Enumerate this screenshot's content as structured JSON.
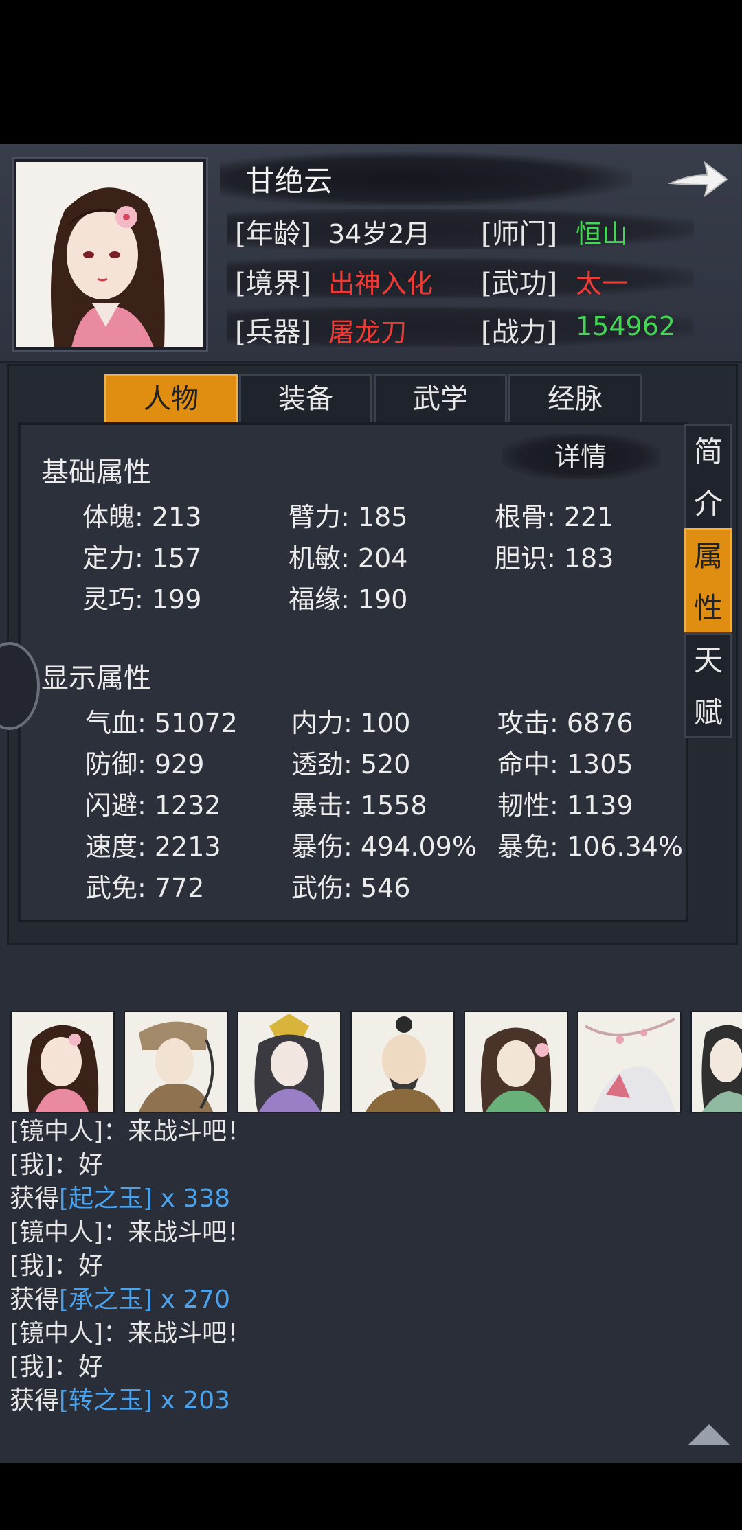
{
  "profile": {
    "name": "甘绝云",
    "rows": [
      {
        "label1": "[年龄]",
        "value1": "34岁2月",
        "label2": "[师门]",
        "value2": "恒山"
      },
      {
        "label1": "[境界]",
        "value1": "出神入化",
        "label2": "[武功]",
        "value2": "太一"
      },
      {
        "label1": "[兵器]",
        "value1": "屠龙刀",
        "label2": "[战力]",
        "value2": "154962"
      }
    ]
  },
  "tabs": [
    "人物",
    "装备",
    "武学",
    "经脉"
  ],
  "detail_label": "详情",
  "side_tabs": [
    {
      "chars": [
        "简",
        "介"
      ]
    },
    {
      "chars": [
        "属",
        "性"
      ]
    },
    {
      "chars": [
        "天",
        "赋"
      ]
    }
  ],
  "base_section": {
    "title": "基础属性",
    "stats": [
      "体魄: 213",
      "臂力: 185",
      "根骨: 221",
      "定力: 157",
      "机敏: 204",
      "胆识: 183",
      "灵巧: 199",
      "福缘: 190"
    ]
  },
  "display_section": {
    "title": "显示属性",
    "stats": [
      "气血: 51072",
      "内力: 100",
      "攻击: 6876",
      "防御: 929",
      "透劲: 520",
      "命中: 1305",
      "闪避: 1232",
      "暴击: 1558",
      "韧性: 1139",
      "速度: 2213",
      "暴伤: 494.09%",
      "暴免: 106.34%",
      "武免: 772",
      "武伤: 546"
    ]
  },
  "log": [
    {
      "pre": "[镜中人]：来战斗吧！",
      "item": "",
      "post": ""
    },
    {
      "pre": "[我]：好",
      "item": "",
      "post": ""
    },
    {
      "pre": "获得",
      "item": "[起之玉]",
      "post": " x 338"
    },
    {
      "pre": "[镜中人]：来战斗吧！",
      "item": "",
      "post": ""
    },
    {
      "pre": "[我]：好",
      "item": "",
      "post": ""
    },
    {
      "pre": "获得",
      "item": "[承之玉]",
      "post": " x 270"
    },
    {
      "pre": "[镜中人]：来战斗吧！",
      "item": "",
      "post": ""
    },
    {
      "pre": "[我]：好",
      "item": "",
      "post": ""
    },
    {
      "pre": "获得",
      "item": "[转之玉]",
      "post": " x 203"
    }
  ],
  "colors": {
    "accent": "#e08e12",
    "red_value": "#ee3b36",
    "green_value": "#42d653",
    "item_blue": "#4aa3ee"
  }
}
